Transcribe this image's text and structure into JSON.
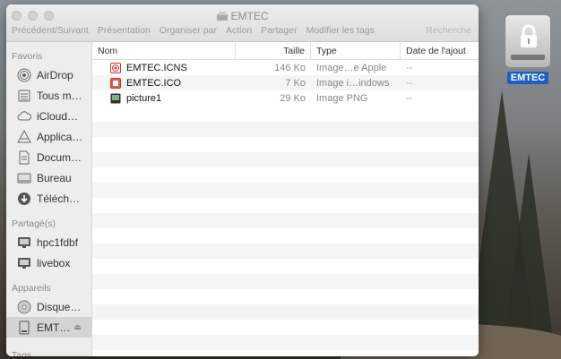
{
  "window": {
    "title": "EMTEC",
    "toolbar": [
      "Précédent/Suivant",
      "Présentation",
      "Organiser par",
      "Action",
      "Partager",
      "Modifier les tags"
    ],
    "search_label": "Recherche"
  },
  "sidebar": {
    "favoris_header": "Favoris",
    "favoris": [
      {
        "label": "AirDrop",
        "icon": "airdrop-icon"
      },
      {
        "label": "Tous m…",
        "icon": "all-files-icon"
      },
      {
        "label": "iCloud…",
        "icon": "cloud-icon"
      },
      {
        "label": "Applica…",
        "icon": "applications-icon"
      },
      {
        "label": "Docum…",
        "icon": "document-icon"
      },
      {
        "label": "Bureau",
        "icon": "desktop-icon"
      },
      {
        "label": "Téléch…",
        "icon": "download-icon"
      }
    ],
    "partage_header": "Partagé(s)",
    "partage": [
      {
        "label": "hpc1fdbf",
        "icon": "monitor-icon"
      },
      {
        "label": "livebox",
        "icon": "monitor-icon"
      }
    ],
    "appareils_header": "Appareils",
    "appareils": [
      {
        "label": "Disque…",
        "icon": "disk-icon"
      },
      {
        "label": "EMT…",
        "icon": "drive-icon"
      }
    ],
    "tags_header": "Tags"
  },
  "columns": {
    "name": "Nom",
    "size": "Taille",
    "type": "Type",
    "date": "Date de l'ajout"
  },
  "files": [
    {
      "name": "EMTEC.ICNS",
      "size": "146 Ko",
      "type": "Image…e Apple",
      "date": "--",
      "icon": "icns-file-icon"
    },
    {
      "name": "EMTEC.ICO",
      "size": "7 Ko",
      "type": "Image i…indows",
      "date": "--",
      "icon": "ico-file-icon"
    },
    {
      "name": "picture1",
      "size": "29 Ko",
      "type": "Image PNG",
      "date": "--",
      "icon": "png-file-icon"
    }
  ],
  "desktop": {
    "drive_label": "EMTEC"
  }
}
